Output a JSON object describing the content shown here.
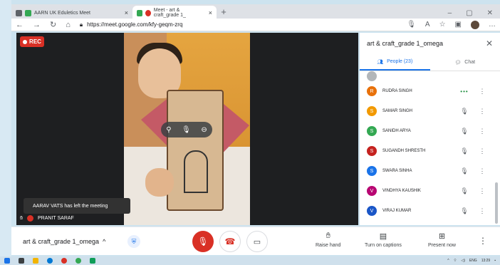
{
  "browser": {
    "tabs": [
      {
        "label": "AARN UK Eduletics Meet",
        "active": false
      },
      {
        "label": "Meet - art & craft_grade 1_",
        "active": true
      }
    ],
    "url": "https://meet.google.com/kfy-geqm-zrq"
  },
  "video": {
    "rec_label": "REC",
    "toast": "AARAV VATS has left the meeting",
    "tile_name": "PRANIT SARAF"
  },
  "panel": {
    "title": "art & craft_grade 1_omega",
    "people_tab": "People (23)",
    "chat_tab": "Chat",
    "participants": [
      {
        "initial": "R",
        "name": "RUDRA SINGH",
        "color": "#e8710a",
        "speaking": true
      },
      {
        "initial": "S",
        "name": "SAMAR SINGH",
        "color": "#f29900",
        "speaking": false
      },
      {
        "initial": "S",
        "name": "SANIDH ARYA",
        "color": "#33a852",
        "speaking": false
      },
      {
        "initial": "S",
        "name": "SUGANDH SHRESTH",
        "color": "#c5221f",
        "speaking": false
      },
      {
        "initial": "S",
        "name": "SWARA SINHA",
        "color": "#1a73e8",
        "speaking": false
      },
      {
        "initial": "V",
        "name": "VINDHYA KAUSHIK",
        "color": "#b80672",
        "speaking": false
      },
      {
        "initial": "V",
        "name": "VIRAJ KUMAR",
        "color": "#1a56c7",
        "speaking": false
      }
    ]
  },
  "bottom": {
    "meeting_title": "art & craft_grade 1_omega",
    "raise_hand": "Raise hand",
    "captions": "Turn on captions",
    "present": "Present now"
  },
  "taskbar": {
    "lang": "ENG",
    "time": "13:29"
  },
  "colors": {
    "accent": "#1a73e8",
    "danger": "#d93025"
  }
}
